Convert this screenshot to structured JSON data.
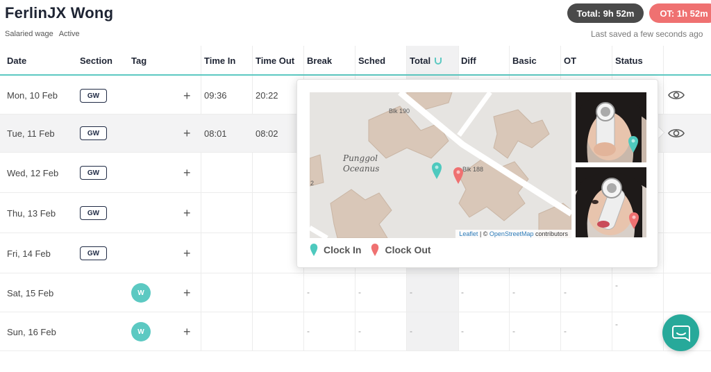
{
  "employee": {
    "name": "FerlinJX Wong",
    "wage_type": "Salaried wage",
    "status": "Active"
  },
  "summary": {
    "total": "Total: 9h 52m",
    "ot": "OT: 1h 52m",
    "last_saved": "Last saved a few seconds ago"
  },
  "colors": {
    "accent": "#5cc9c2",
    "clock_in": "#4ec9be",
    "clock_out": "#ef7171",
    "total_pill": "#4a4a4a",
    "chat": "#27a99a"
  },
  "columns": [
    "Date",
    "Section",
    "Tag",
    "Time In",
    "Time Out",
    "Break",
    "Sched",
    "Total",
    "Diff",
    "Basic",
    "OT",
    "Status"
  ],
  "rows": [
    {
      "date": "Mon, 10 Feb",
      "section": "GW",
      "time_in": "09:36",
      "time_out": "20:22"
    },
    {
      "date": "Tue, 11 Feb",
      "section": "GW",
      "time_in": "08:01",
      "time_out": "08:02"
    },
    {
      "date": "Wed, 12 Feb",
      "section": "GW"
    },
    {
      "date": "Thu, 13 Feb",
      "section": "GW"
    },
    {
      "date": "Fri, 14 Feb",
      "section": "GW"
    },
    {
      "date": "Sat, 15 Feb",
      "tag": "W",
      "dash": "-"
    },
    {
      "date": "Sun, 16 Feb",
      "tag": "W",
      "dash": "-"
    }
  ],
  "popup": {
    "map_labels": {
      "blk190": "Blk 190",
      "blk188": "Blk 188",
      "place1": "Punggol",
      "place2": "Oceanus",
      "edge": "2"
    },
    "attribution": {
      "leaflet": "Leaflet",
      "sep": " | © ",
      "osm": "OpenStreetMap",
      "suffix": " contributors"
    },
    "legend": {
      "clock_in": "Clock In",
      "clock_out": "Clock Out"
    }
  },
  "icons": {
    "plus": "+",
    "eye": "eye-icon",
    "magnet": "magnet-icon",
    "chat": "chat-icon",
    "pin": "map-pin-icon"
  }
}
